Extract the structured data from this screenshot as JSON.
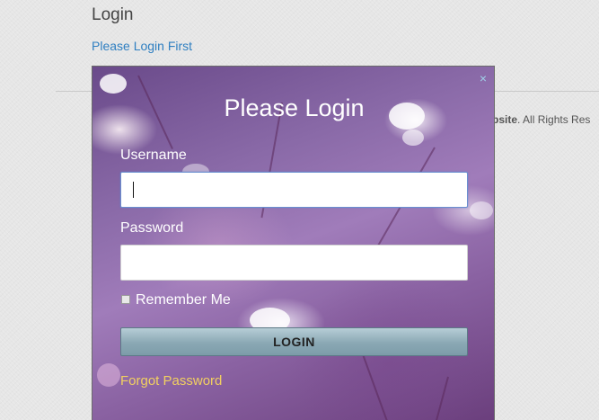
{
  "page": {
    "heading": "Login",
    "notice_link": "Please Login First"
  },
  "footer": {
    "site_fragment": "psite",
    "rights_text": ". All Rights Res"
  },
  "modal": {
    "title": "Please Login",
    "close_symbol": "×",
    "username_label": "Username",
    "username_value": "",
    "password_label": "Password",
    "password_value": "",
    "remember_label": "Remember Me",
    "remember_checked": false,
    "login_button": "LOGIN",
    "forgot_link": "Forgot Password"
  },
  "colors": {
    "link": "#2f7fc1",
    "forgot_link": "#f2d060",
    "modal_background": "#8a6aa8"
  }
}
